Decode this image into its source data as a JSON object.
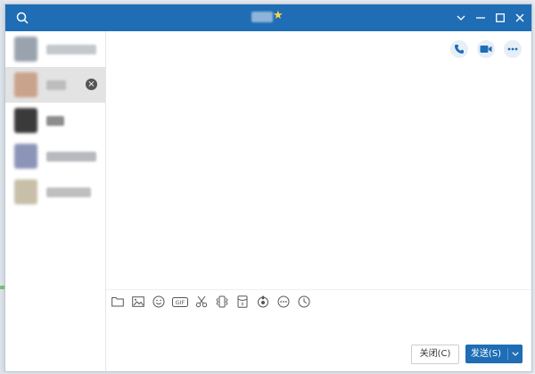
{
  "window": {
    "title": "",
    "title_icon": "star-icon"
  },
  "titlebar": {
    "search_icon": "search-icon",
    "controls": [
      "chevron-down-icon",
      "minimize-icon",
      "maximize-icon",
      "close-icon"
    ]
  },
  "sidebar": {
    "contacts": [
      {
        "name": "",
        "active": false,
        "avatar_color": "#9aa3ad"
      },
      {
        "name": "",
        "active": true,
        "avatar_color": "#c9a38a"
      },
      {
        "name": "",
        "active": false,
        "avatar_color": "#3a3a3a"
      },
      {
        "name": "",
        "active": false,
        "avatar_color": "#8c95b8"
      },
      {
        "name": "",
        "active": false,
        "avatar_color": "#c7bfa8"
      }
    ]
  },
  "header_actions": [
    "phone-icon",
    "video-icon",
    "more-icon"
  ],
  "toolbar": {
    "tools": [
      "folder-icon",
      "image-icon",
      "emoji-icon",
      "gif-icon",
      "scissors-icon",
      "vibrate-icon",
      "red-packet-icon",
      "voice-icon",
      "more-circle-icon",
      "history-icon"
    ]
  },
  "buttons": {
    "close_label": "关闭(C)",
    "send_label": "发送(S)"
  },
  "colors": {
    "titlebar": "#1e6db5",
    "accent": "#1e6db5",
    "active_row": "#e3e3e3"
  }
}
